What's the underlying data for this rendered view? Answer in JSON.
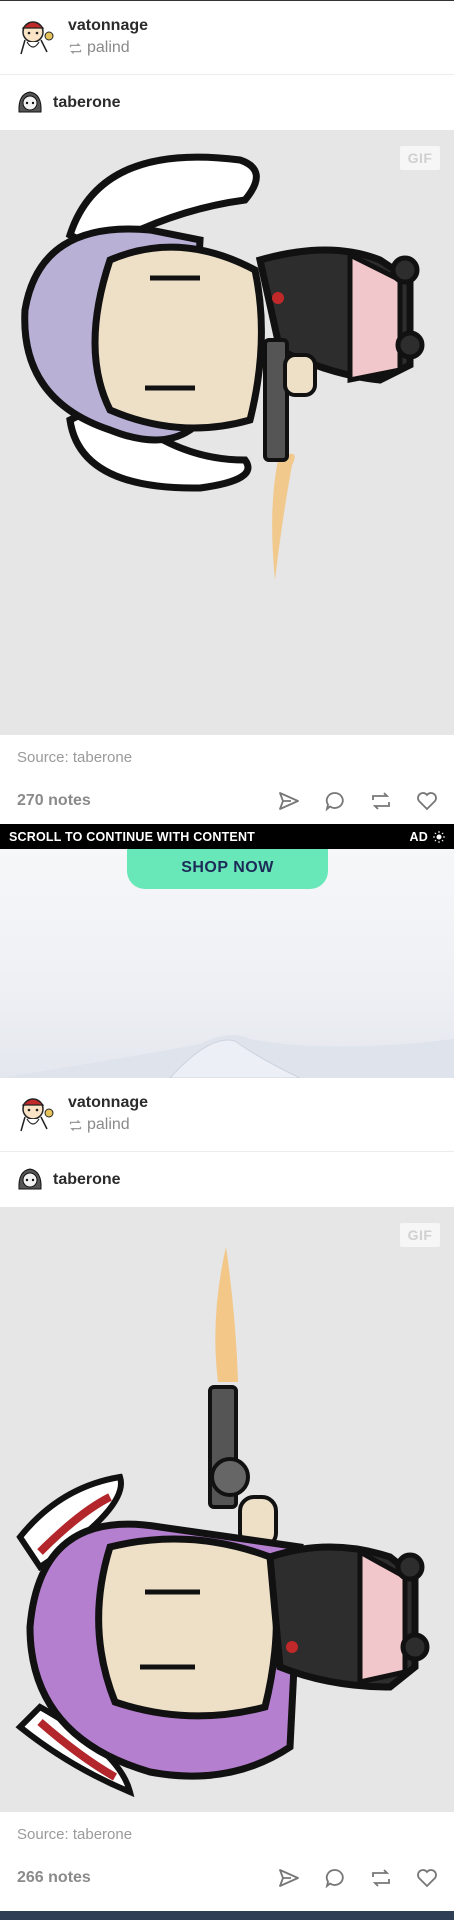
{
  "posts": [
    {
      "reblogger": "vatonnage",
      "via": "palind",
      "author": "taberone",
      "gif_badge": "GIF",
      "source": "Source: taberone",
      "notes": "270 notes"
    },
    {
      "reblogger": "vatonnage",
      "via": "palind",
      "author": "taberone",
      "gif_badge": "GIF",
      "source": "Source: taberone",
      "notes": "266 notes"
    }
  ],
  "ad": {
    "scroll_label": "SCROLL TO CONTINUE WITH CONTENT",
    "ad_label": "AD",
    "cta": "SHOP NOW",
    "cta_color": "#68e8b8"
  },
  "icons": [
    "reblog-small-icon",
    "share-icon",
    "reply-icon",
    "reblog-icon",
    "like-icon",
    "ad-info-icon"
  ],
  "colors": {
    "gif_background": "#e6e6e6",
    "character_hair_1": "#b9b0d6",
    "character_hair_2": "#b57fcf",
    "muzzle_flash": "#f3c37c"
  }
}
